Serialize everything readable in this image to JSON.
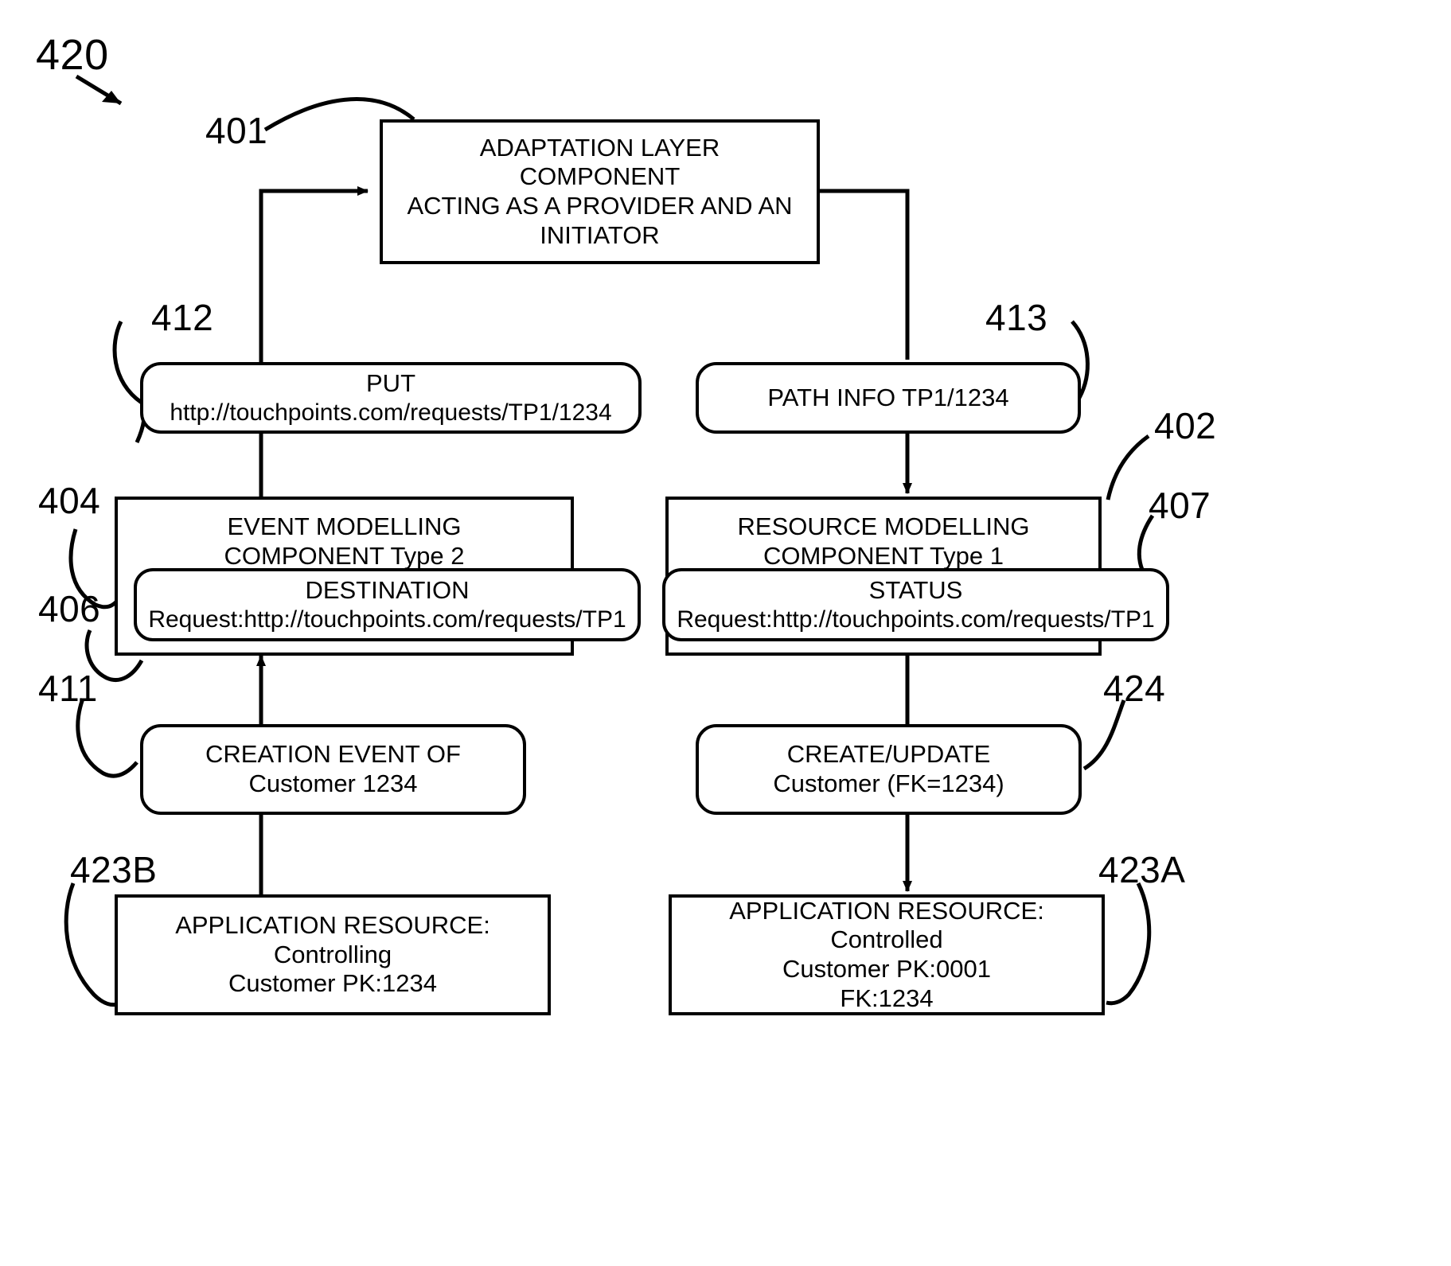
{
  "figure": {
    "label": "420",
    "type": "patent-flow-diagram"
  },
  "ref_numbers": {
    "fig": "420",
    "adaptation_layer": "401",
    "put": "412",
    "path_info": "413",
    "event_modelling": "404",
    "destination": "406",
    "resource_modelling": "402",
    "status": "407",
    "creation_event": "411",
    "create_update": "424",
    "app_resource_left": "423B",
    "app_resource_right": "423A"
  },
  "nodes": {
    "adaptation_layer": {
      "lines": [
        "ADAPTATION LAYER",
        "COMPONENT",
        "ACTING AS A PROVIDER AND AN",
        "INITIATOR"
      ]
    },
    "put": {
      "lines": [
        "PUT",
        "http://touchpoints.com/requests/TP1/1234"
      ]
    },
    "path_info": {
      "lines": [
        "PATH INFO TP1/1234"
      ]
    },
    "event_modelling": {
      "lines": [
        "EVENT MODELLING",
        "COMPONENT Type 2"
      ]
    },
    "destination": {
      "lines": [
        "DESTINATION",
        "Request:http://touchpoints.com/requests/TP1"
      ]
    },
    "resource_modelling": {
      "lines": [
        "RESOURCE MODELLING",
        "COMPONENT Type 1"
      ]
    },
    "status": {
      "lines": [
        "STATUS",
        "Request:http://touchpoints.com/requests/TP1"
      ]
    },
    "creation_event": {
      "lines": [
        "CREATION EVENT OF",
        "Customer 1234"
      ]
    },
    "create_update": {
      "lines": [
        "CREATE/UPDATE",
        "Customer (FK=1234)"
      ]
    },
    "app_resource_left": {
      "lines": [
        "APPLICATION RESOURCE:",
        "Controlling",
        "Customer PK:1234"
      ]
    },
    "app_resource_right": {
      "lines": [
        "APPLICATION RESOURCE:",
        "Controlled",
        "Customer PK:0001",
        "FK:1234"
      ]
    }
  },
  "colors": {
    "stroke": "#000000",
    "background": "#ffffff"
  }
}
